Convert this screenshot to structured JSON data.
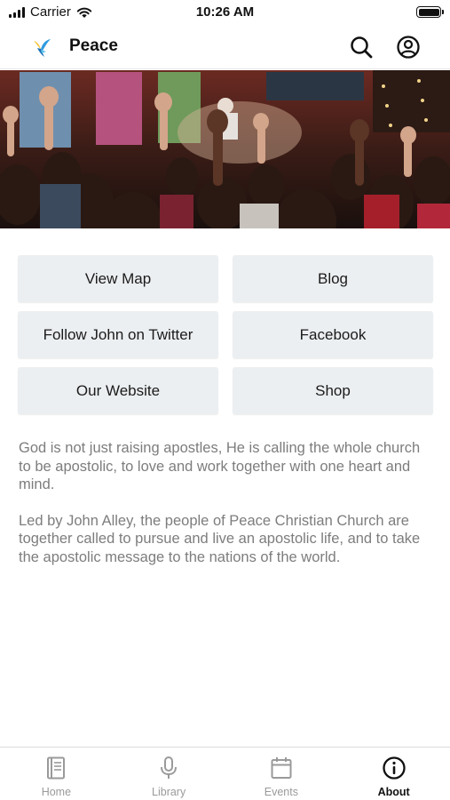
{
  "status_bar": {
    "carrier": "Carrier",
    "time": "10:26 AM"
  },
  "header": {
    "title": "Peace",
    "logo_icon": "dove-logo-icon",
    "actions": [
      "search-icon",
      "account-icon"
    ]
  },
  "hero": {
    "image": "worship-crowd-raising-hands"
  },
  "links": {
    "view_map": "View Map",
    "blog": "Blog",
    "twitter": "Follow John on Twitter",
    "facebook": "Facebook",
    "website": "Our Website",
    "shop": "Shop"
  },
  "about": {
    "paragraph_1": "God is not just raising apostles, He is calling the whole church to be apostolic, to love and work together with one heart and mind.",
    "paragraph_2": "Led by John Alley, the people of Peace Christian Church are together called to pursue and live an apostolic life, and to take the apostolic message to the nations of the world."
  },
  "tabs": {
    "home": "Home",
    "library": "Library",
    "events": "Events",
    "about": "About",
    "active": "About"
  },
  "colors": {
    "button_bg": "#eceff1",
    "body_text": "#7d7d7d",
    "tab_inactive": "#9a9a9a",
    "tab_active": "#111111",
    "logo_blue": "#2f9be0",
    "logo_yellow": "#f2c12e"
  }
}
